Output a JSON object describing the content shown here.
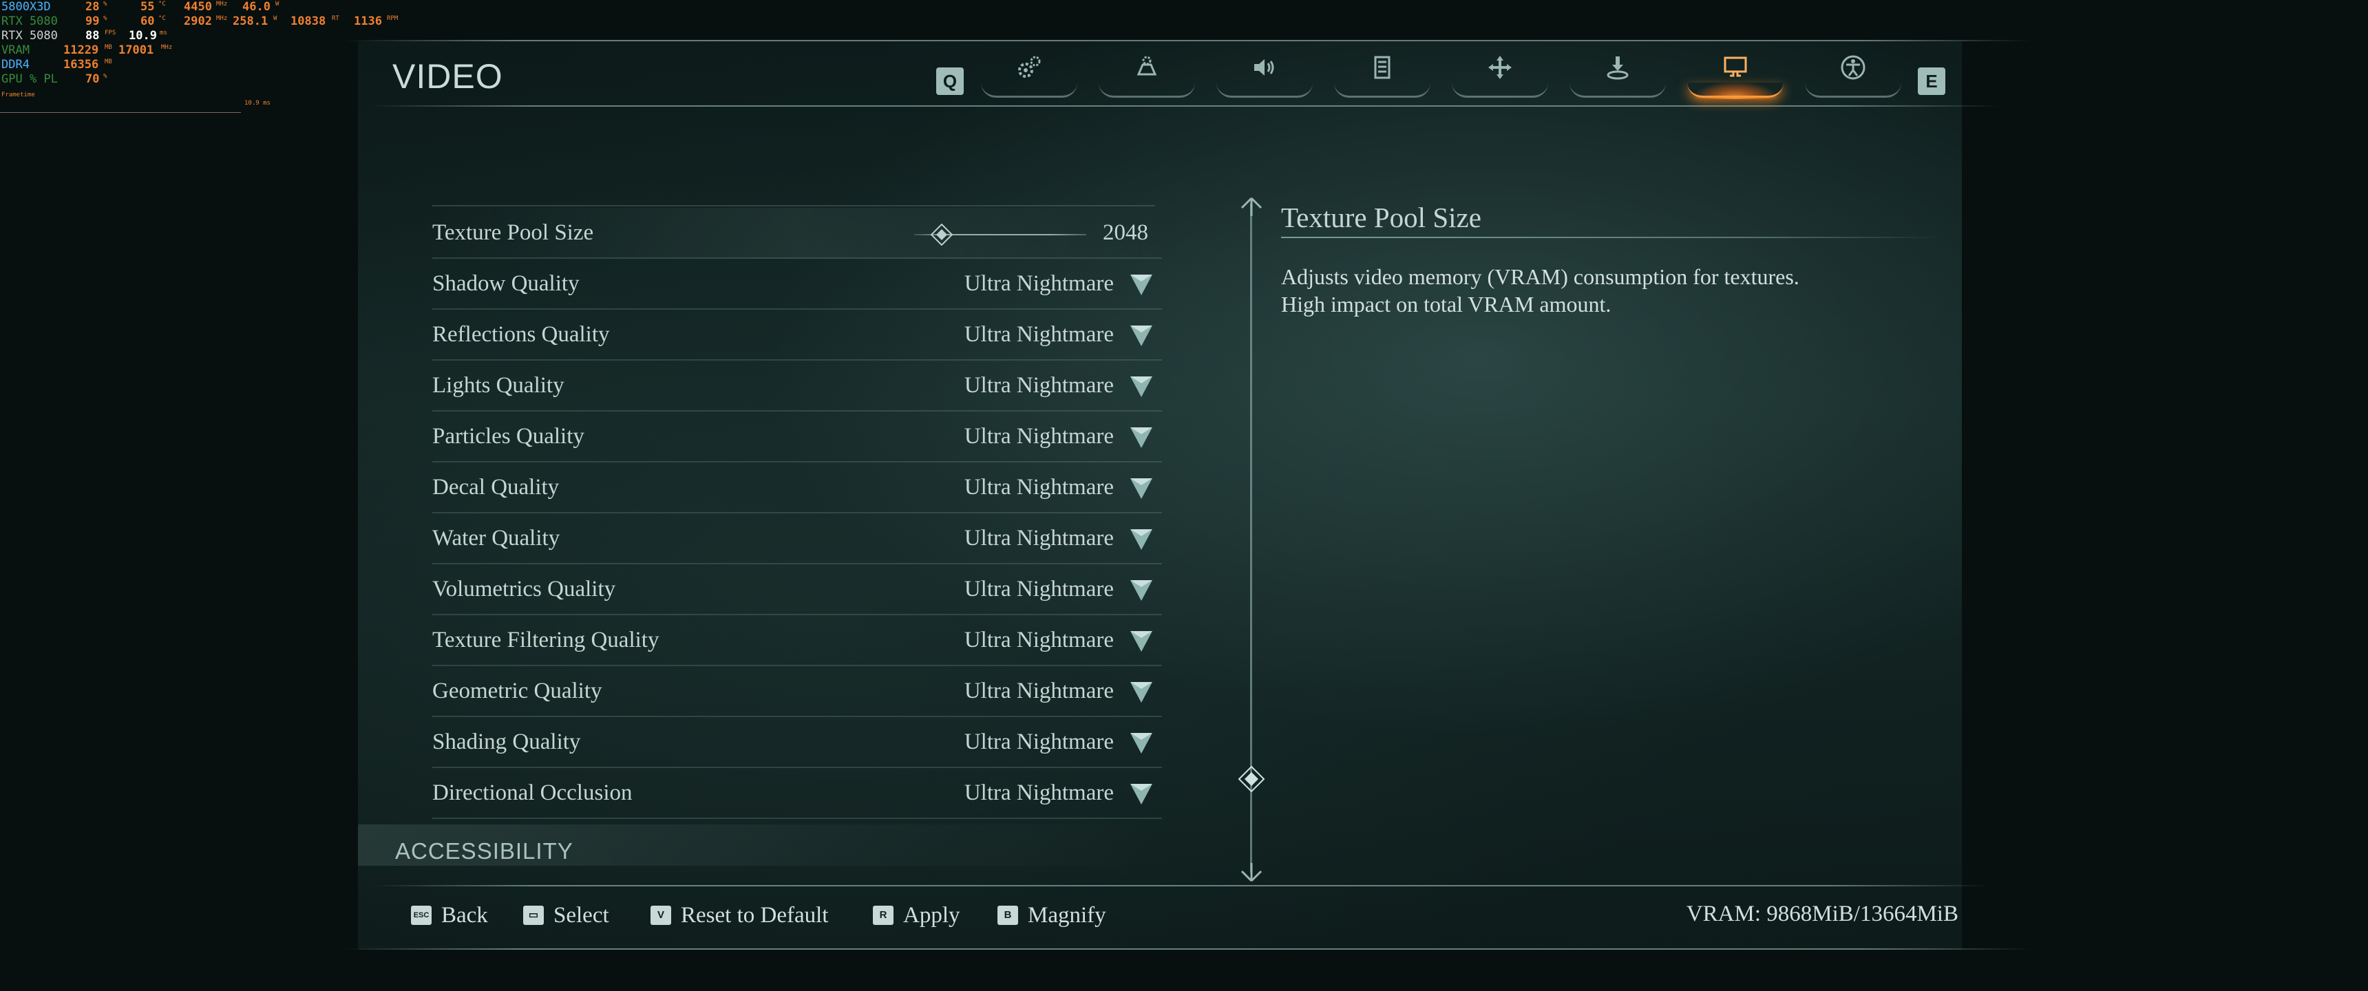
{
  "overlay": {
    "rows": [
      {
        "label": "5800X3D",
        "v1": "28",
        "u1": "%",
        "v2": "55",
        "u2": "°C",
        "v3": "4450",
        "u3": "MHz",
        "v4": "46.0",
        "u4": "W"
      },
      {
        "label": "RTX 5080",
        "v1": "99",
        "u1": "%",
        "v2": "60",
        "u2": "°C",
        "v3": "2902",
        "u3": "MHz",
        "v4": "258.1",
        "u4": "W",
        "v5": "10838",
        "u5": "RT",
        "v6": "1136",
        "u6": "RPM"
      },
      {
        "label": "RTX 5080",
        "v1": "88",
        "u1": "FPS",
        "v2": "10.9",
        "u2": "ms"
      },
      {
        "label": "VRAM",
        "v1": "11229",
        "u1": "MB",
        "v2": "17001",
        "u2": "MHz"
      },
      {
        "label": "DDR4",
        "v1": "16356",
        "u1": "MB"
      },
      {
        "label": "GPU % PL",
        "v1": "70",
        "u1": "%"
      }
    ],
    "frametime_label": "Frametime",
    "frametime_value": "10.9 ms"
  },
  "header": {
    "title": "VIDEO",
    "prev_key": "Q",
    "next_key": "E",
    "tabs": [
      {
        "icon": "gears-icon",
        "active": false
      },
      {
        "icon": "controller-settings-icon",
        "active": false
      },
      {
        "icon": "audio-icon",
        "active": false
      },
      {
        "icon": "menu-list-icon",
        "active": false
      },
      {
        "icon": "move-icon",
        "active": false
      },
      {
        "icon": "download-icon",
        "active": false
      },
      {
        "icon": "monitor-icon",
        "active": true
      },
      {
        "icon": "accessibility-icon",
        "active": false
      }
    ]
  },
  "settings": {
    "texture_pool": {
      "label": "Texture Pool Size",
      "value": "2048"
    },
    "rows": [
      {
        "label": "Shadow Quality",
        "value": "Ultra Nightmare"
      },
      {
        "label": "Reflections Quality",
        "value": "Ultra Nightmare"
      },
      {
        "label": "Lights Quality",
        "value": "Ultra Nightmare"
      },
      {
        "label": "Particles Quality",
        "value": "Ultra Nightmare"
      },
      {
        "label": "Decal Quality",
        "value": "Ultra Nightmare"
      },
      {
        "label": "Water Quality",
        "value": "Ultra Nightmare"
      },
      {
        "label": "Volumetrics Quality",
        "value": "Ultra Nightmare"
      },
      {
        "label": "Texture Filtering Quality",
        "value": "Ultra Nightmare"
      },
      {
        "label": "Geometric Quality",
        "value": "Ultra Nightmare"
      },
      {
        "label": "Shading Quality",
        "value": "Ultra Nightmare"
      },
      {
        "label": "Directional Occlusion",
        "value": "Ultra Nightmare"
      }
    ],
    "next_section": "ACCESSIBILITY"
  },
  "description": {
    "title": "Texture Pool Size",
    "body": "Adjusts video memory (VRAM) consumption for textures. High impact on total VRAM amount."
  },
  "footer": {
    "back": {
      "key": "ESC",
      "label": "Back"
    },
    "select": {
      "key": "▭",
      "label": "Select"
    },
    "reset": {
      "key": "V",
      "label": "Reset to Default"
    },
    "apply": {
      "key": "R",
      "label": "Apply"
    },
    "magnify": {
      "key": "B",
      "label": "Magnify"
    },
    "vram": "VRAM: 9868MiB/13664MiB"
  },
  "colors": {
    "accent": "#ff9a3a",
    "text": "#c6d6d3",
    "background": "#07100f"
  }
}
